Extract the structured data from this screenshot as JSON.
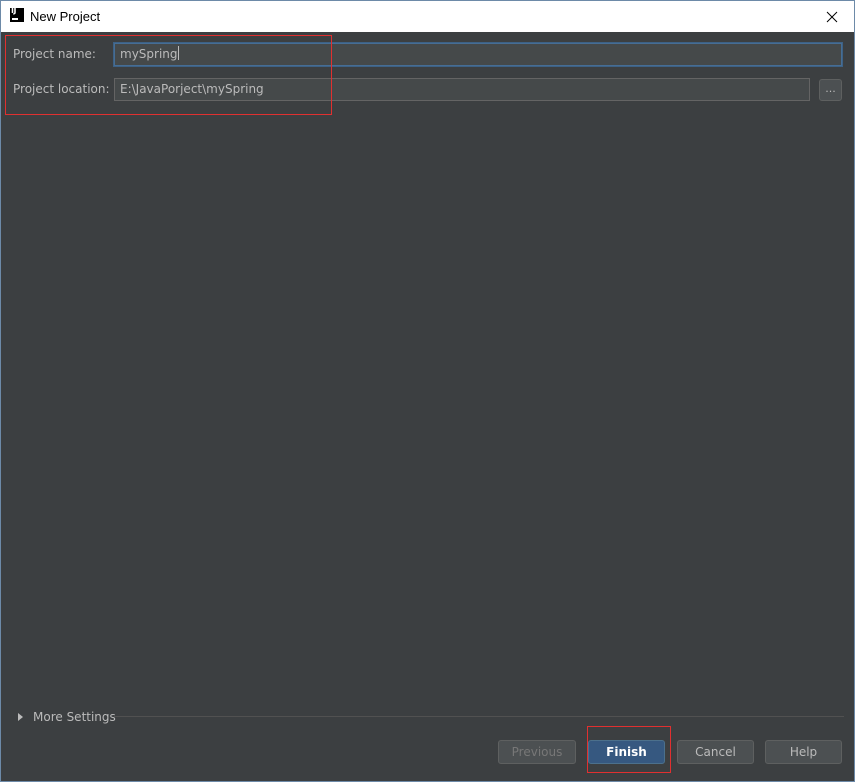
{
  "window": {
    "title": "New Project",
    "app_icon_text": "IJ"
  },
  "form": {
    "project_name_label": "Project name:",
    "project_name_value": "mySpring",
    "project_location_label": "Project location:",
    "project_location_value": "E:\\JavaPorject\\mySpring",
    "browse_label": "..."
  },
  "more_settings": {
    "label": "More Settings",
    "expanded": false
  },
  "buttons": {
    "previous": "Previous",
    "finish": "Finish",
    "cancel": "Cancel",
    "help": "Help"
  },
  "colors": {
    "background": "#3c3f41",
    "input_background": "#45494a",
    "text": "#bbbbbb",
    "primary_button": "#365880",
    "annotation": "#e03030"
  }
}
